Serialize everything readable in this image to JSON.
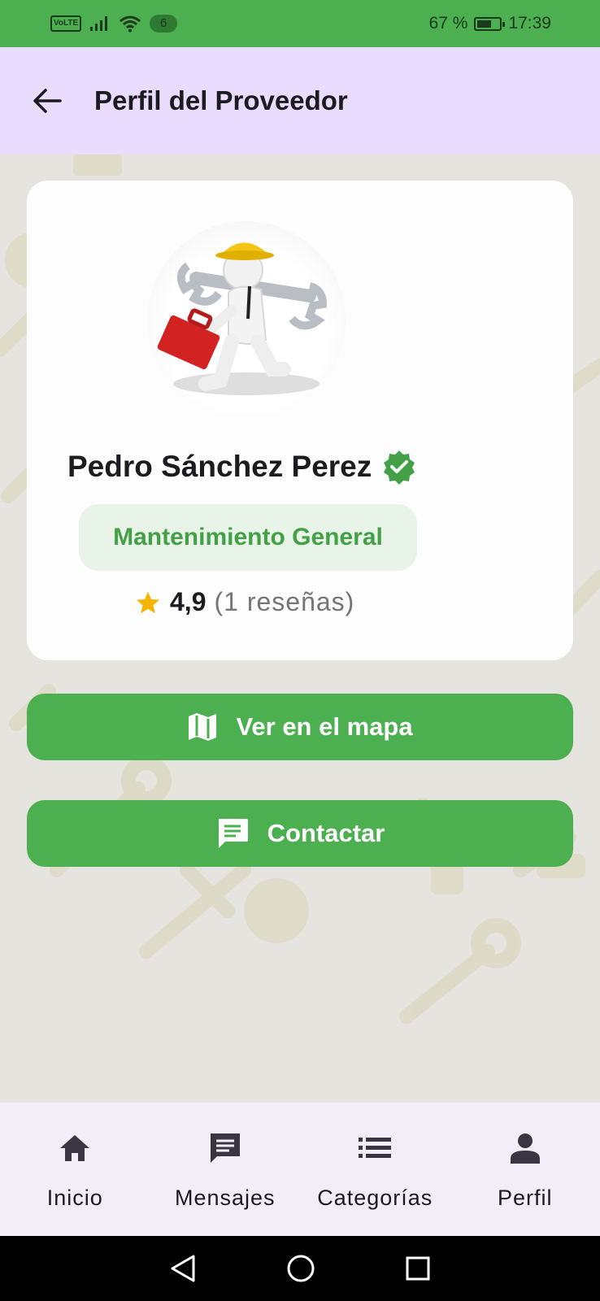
{
  "status_bar": {
    "volte": "VoLTE",
    "sim_badge": "6",
    "battery_percent": "67 %",
    "battery_level": 0.67,
    "time": "17:39"
  },
  "app_bar": {
    "title": "Perfil del Proveedor",
    "back_icon": "arrow-back-icon"
  },
  "profile": {
    "name": "Pedro Sánchez Perez",
    "verified_icon": "verified-badge-icon",
    "category": "Mantenimiento General",
    "rating": "4,9",
    "reviews": "(1 reseñas)",
    "rating_value": 4.9
  },
  "actions": {
    "map_label": "Ver en el mapa",
    "map_icon": "map-icon",
    "contact_label": "Contactar",
    "contact_icon": "chat-icon"
  },
  "bottom_nav": {
    "items": [
      {
        "label": "Inicio",
        "icon": "home-icon"
      },
      {
        "label": "Mensajes",
        "icon": "message-icon"
      },
      {
        "label": "Categorías",
        "icon": "list-icon"
      },
      {
        "label": "Perfil",
        "icon": "person-icon"
      }
    ]
  },
  "colors": {
    "primary_green": "#4caf50",
    "app_bar": "#eadcff",
    "chip_background": "#e8f4e8",
    "star": "#f5b400",
    "bottom_nav": "#f3edf7"
  }
}
